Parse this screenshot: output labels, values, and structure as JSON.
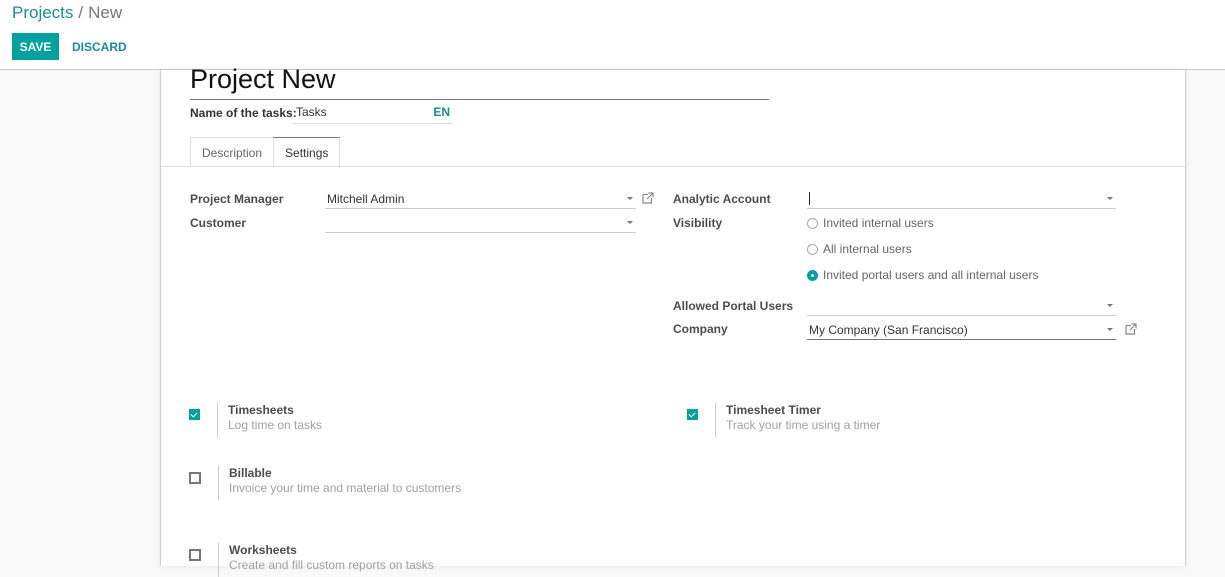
{
  "breadcrumb": {
    "parent": "Projects",
    "separator": "/",
    "current": "New"
  },
  "toolbar": {
    "save_label": "SAVE",
    "discard_label": "DISCARD"
  },
  "form": {
    "title": "Project New",
    "task_name_label": "Name of the tasks:",
    "task_name_value": "Tasks",
    "lang_badge": "EN",
    "tabs": [
      {
        "label": "Description",
        "active": false
      },
      {
        "label": "Settings",
        "active": true
      }
    ],
    "left_fields": {
      "project_manager": {
        "label": "Project Manager",
        "value": "Mitchell Admin"
      },
      "customer": {
        "label": "Customer",
        "value": ""
      }
    },
    "right_fields": {
      "analytic_account": {
        "label": "Analytic Account",
        "value": ""
      },
      "visibility": {
        "label": "Visibility",
        "options": [
          {
            "label": "Invited internal users",
            "checked": false
          },
          {
            "label": "All internal users",
            "checked": false
          },
          {
            "label": "Invited portal users and all internal users",
            "checked": true
          }
        ]
      },
      "allowed_portal_users": {
        "label": "Allowed Portal Users",
        "value": ""
      },
      "company": {
        "label": "Company",
        "value": "My Company (San Francisco)"
      }
    },
    "settings": [
      {
        "title": "Timesheets",
        "desc": "Log time on tasks",
        "checked": true
      },
      {
        "title": "Timesheet Timer",
        "desc": "Track your time using a timer",
        "checked": true
      },
      {
        "title": "Billable",
        "desc": "Invoice your time and material to customers",
        "checked": false
      },
      {
        "title": "Worksheets",
        "desc": "Create and fill custom reports on tasks",
        "checked": false
      }
    ]
  },
  "colors": {
    "accent": "#00a09d",
    "link": "#1b8d91"
  }
}
